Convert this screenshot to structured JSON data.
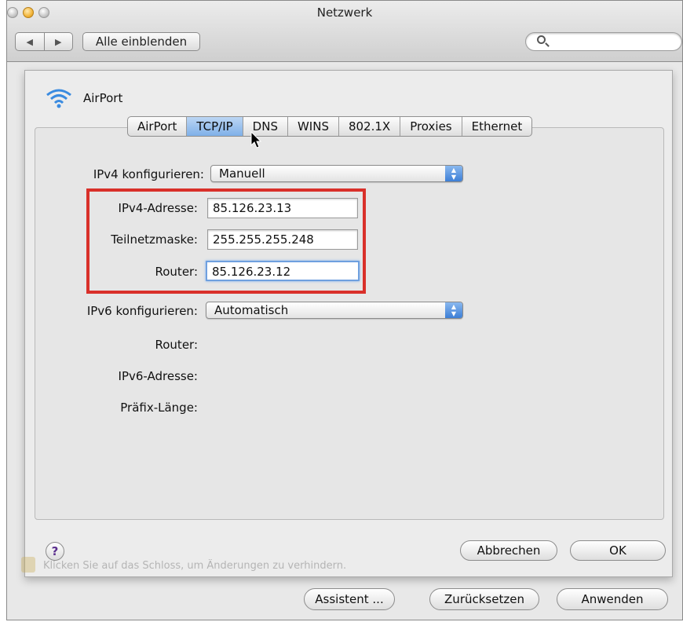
{
  "window": {
    "title": "Netzwerk",
    "back_glyph": "◀",
    "forward_glyph": "▶",
    "show_all_label": "Alle einblenden",
    "search_placeholder": ""
  },
  "sheet": {
    "interface_name": "AirPort",
    "tabs": [
      {
        "label": "AirPort",
        "active": false
      },
      {
        "label": "TCP/IP",
        "active": true
      },
      {
        "label": "DNS",
        "active": false
      },
      {
        "label": "WINS",
        "active": false
      },
      {
        "label": "802.1X",
        "active": false
      },
      {
        "label": "Proxies",
        "active": false
      },
      {
        "label": "Ethernet",
        "active": false
      }
    ],
    "ipv4_config_label": "IPv4 konfigurieren:",
    "ipv4_config_value": "Manuell",
    "ipv4_address_label": "IPv4-Adresse:",
    "ipv4_address_value": "85.126.23.13",
    "subnet_label": "Teilnetzmaske:",
    "subnet_value": "255.255.255.248",
    "router_label": "Router:",
    "router_value": "85.126.23.12",
    "ipv6_config_label": "IPv6 konfigurieren:",
    "ipv6_config_value": "Automatisch",
    "ipv6_router_label": "Router:",
    "ipv6_address_label": "IPv6-Adresse:",
    "prefix_label": "Präfix-Länge:",
    "help_glyph": "?",
    "cancel_label": "Abbrechen",
    "ok_label": "OK"
  },
  "footer": {
    "lock_hint": "Klicken Sie auf das Schloss, um Änderungen zu verhindern.",
    "assistant_label": "Assistent ...",
    "revert_label": "Zurücksetzen",
    "apply_label": "Anwenden"
  },
  "colors": {
    "highlight_box": "#d9302a",
    "active_tab": "#7fb0e8",
    "popup_arrow": "#3d7fd6"
  },
  "icons": {
    "airport": "wifi-icon",
    "search": "search-icon",
    "help": "help-icon",
    "lock": "lock-icon",
    "cursor": "pointer-cursor-icon"
  }
}
